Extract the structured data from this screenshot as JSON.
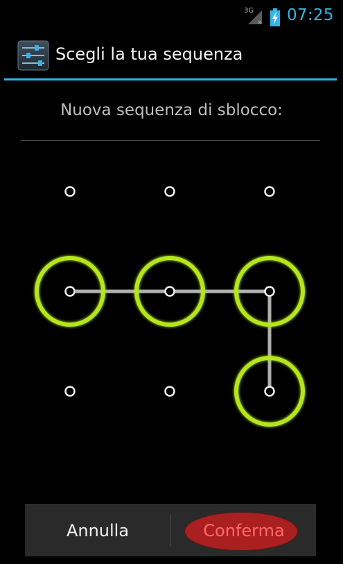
{
  "status_bar": {
    "network_label": "3G",
    "clock": "07:25",
    "accent_color": "#33b5e5",
    "icons": [
      "signal-icon",
      "battery-charging-icon"
    ]
  },
  "action_bar": {
    "title": "Scegli la tua sequenza",
    "icon": "settings-sliders-icon"
  },
  "header": {
    "message": "Nuova sequenza di sblocco:"
  },
  "pattern": {
    "grid_size": 3,
    "selected_sequence": [
      3,
      4,
      5,
      8
    ],
    "ring_color": "#b5e61d",
    "line_color": "#cfcfcf"
  },
  "buttons": {
    "cancel_label": "Annulla",
    "confirm_label": "Conferma",
    "confirm_highlight_color": "#aa1f1f"
  }
}
